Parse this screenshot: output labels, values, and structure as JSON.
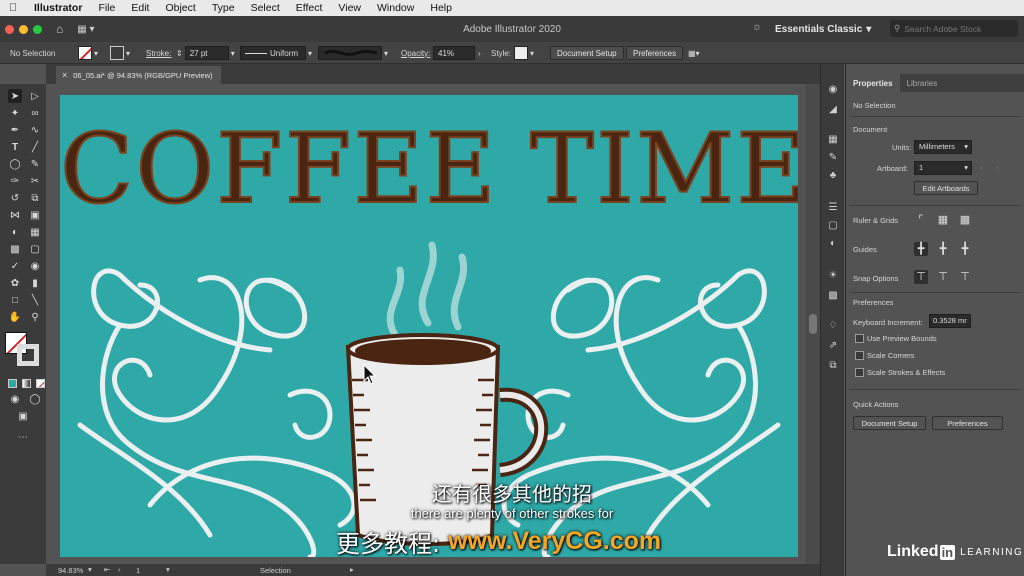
{
  "menubar": {
    "apple": "",
    "items": [
      "Illustrator",
      "File",
      "Edit",
      "Object",
      "Type",
      "Select",
      "Effect",
      "View",
      "Window",
      "Help"
    ]
  },
  "appbar": {
    "title": "Adobe Illustrator 2020",
    "workspace": "Essentials Classic",
    "search_placeholder": "Search Adobe Stock"
  },
  "control": {
    "selection": "No Selection",
    "stroke_label": "Stroke:",
    "stroke_value": "27 pt",
    "profile": "Uniform",
    "opacity_label": "Opacity:",
    "opacity_value": "41%",
    "style_label": "Style:",
    "doc_setup": "Document Setup",
    "preferences": "Preferences"
  },
  "document": {
    "tab": "06_05.ai* @ 94.83% (RGB/GPU Preview)",
    "close": "×"
  },
  "artwork": {
    "headline": "COFFEE TIME",
    "bg_color": "#2fa8a8",
    "ink_color": "#4a2511",
    "swirl_color": "#eaeff0"
  },
  "status": {
    "zoom": "94.83%",
    "artboard": "1",
    "tool": "Selection"
  },
  "panel": {
    "tabs": [
      "Properties",
      "Libraries"
    ],
    "no_selection": "No Selection",
    "document_heading": "Document",
    "units_label": "Units:",
    "units_value": "Millimeters",
    "artboard_label": "Artboard:",
    "artboard_value": "1",
    "edit_artboards": "Edit Artboards",
    "rulers_grids": "Ruler & Grids",
    "guides": "Guides",
    "snap_options": "Snap Options",
    "preferences_heading": "Preferences",
    "keyboard_increment_label": "Keyboard Increment:",
    "keyboard_increment_value": "0.3528 mr",
    "use_preview_bounds": "Use Preview Bounds",
    "scale_corners": "Scale Corners",
    "scale_strokes": "Scale Strokes & Effects",
    "quick_actions": "Quick Actions",
    "qa_document_setup": "Document Setup",
    "qa_preferences": "Preferences"
  },
  "overlay": {
    "subtitle_cn": "还有很多其他的招",
    "subtitle_en": "there are plenty of other strokes for",
    "watermark_cn": "更多教程:",
    "watermark_url": "www.VeryCG.com",
    "linkedin": "Linked",
    "linkedin_in": "in",
    "learning": "LEARNING"
  }
}
